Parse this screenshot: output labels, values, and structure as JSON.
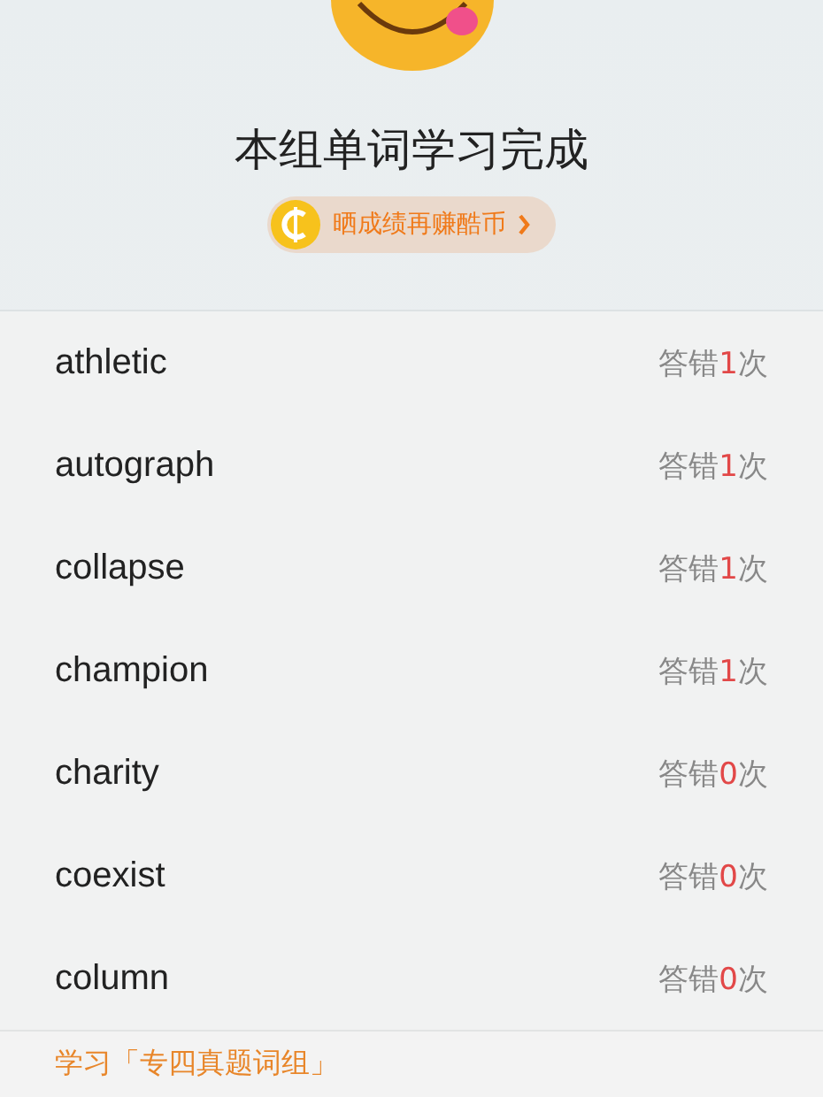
{
  "header": {
    "title": "本组单词学习完成",
    "share_button": {
      "label": "晒成绩再赚酷币"
    }
  },
  "words": [
    {
      "word": "athletic",
      "mistakes": {
        "prefix": "答错",
        "count": "1",
        "suffix": "次"
      }
    },
    {
      "word": "autograph",
      "mistakes": {
        "prefix": "答错",
        "count": "1",
        "suffix": "次"
      }
    },
    {
      "word": "collapse",
      "mistakes": {
        "prefix": "答错",
        "count": "1",
        "suffix": "次"
      }
    },
    {
      "word": "champion",
      "mistakes": {
        "prefix": "答错",
        "count": "1",
        "suffix": "次"
      }
    },
    {
      "word": "charity",
      "mistakes": {
        "prefix": "答错",
        "count": "0",
        "suffix": "次"
      }
    },
    {
      "word": "coexist",
      "mistakes": {
        "prefix": "答错",
        "count": "0",
        "suffix": "次"
      }
    },
    {
      "word": "column",
      "mistakes": {
        "prefix": "答错",
        "count": "0",
        "suffix": "次"
      }
    }
  ],
  "footer": {
    "link": "学习「专四真题词组」"
  }
}
